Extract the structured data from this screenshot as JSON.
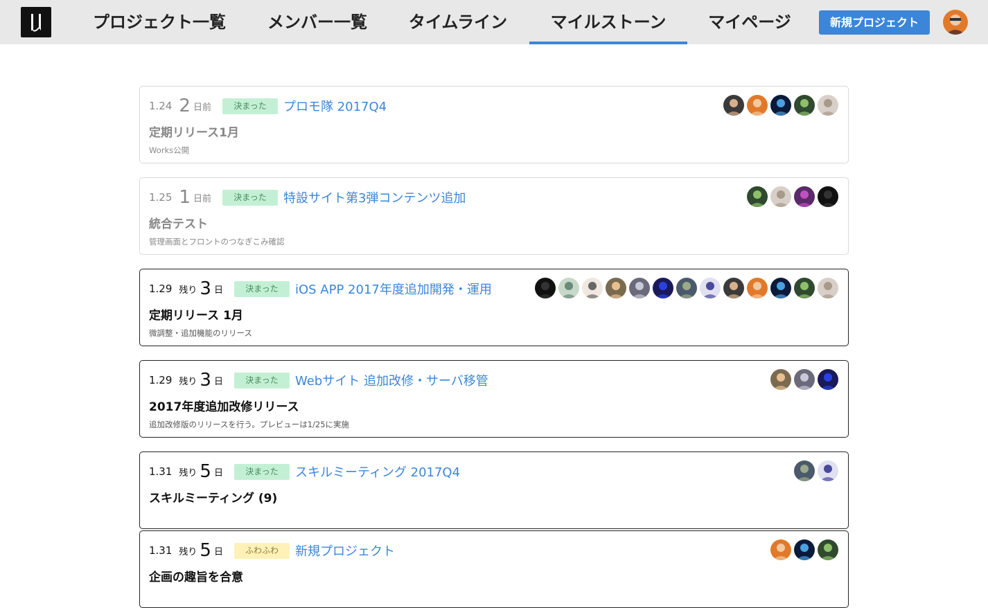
{
  "nav": {
    "tabs": [
      {
        "label": "プロジェクト一覧"
      },
      {
        "label": "メンバー一覧"
      },
      {
        "label": "タイムライン"
      },
      {
        "label": "マイルストーン",
        "active": true
      },
      {
        "label": "マイページ"
      }
    ],
    "new_project_label": "新規プロジェクト"
  },
  "colors": {
    "accent": "#3b86d9",
    "status_decided_bg": "#c3f0d4",
    "status_fuwa_bg": "#fff1b8"
  },
  "milestones": [
    {
      "date": "1.24",
      "days_prefix": "",
      "days": "2",
      "days_suffix": "日前",
      "status": "決まった",
      "project": "プロモ隊 2017Q4",
      "title": "定期リリース1月",
      "description": "Works公開",
      "avatar_count": 5
    },
    {
      "date": "1.25",
      "days_prefix": "",
      "days": "1",
      "days_suffix": "日前",
      "status": "決まった",
      "project": "特設サイト第3弾コンテンツ追加",
      "title": "統合テスト",
      "description": "管理画面とフロントのつなぎこみ確認",
      "avatar_count": 4
    },
    {
      "date": "1.29",
      "days_prefix": "残り",
      "days": "3",
      "days_suffix": "日",
      "status": "決まった",
      "project": "iOS APP 2017年度追加開発・運用",
      "title": "定期リリース 1月",
      "description": "微調整・追加機能のリリース",
      "avatar_count": 13
    },
    {
      "date": "1.29",
      "days_prefix": "残り",
      "days": "3",
      "days_suffix": "日",
      "status": "決まった",
      "project": "Webサイト 追加改修・サーバ移管",
      "title": "2017年度追加改修リリース",
      "description": "追加改修版のリリースを行う。プレビューは1/25に実施",
      "avatar_count": 3
    },
    {
      "date": "1.31",
      "days_prefix": "残り",
      "days": "5",
      "days_suffix": "日",
      "status": "決まった",
      "project": "スキルミーティング 2017Q4",
      "title": "スキルミーティング (9)",
      "description": "",
      "avatar_count": 2
    },
    {
      "date": "1.31",
      "days_prefix": "残り",
      "days": "5",
      "days_suffix": "日",
      "status": "ふわふわ",
      "project": "新規プロジェクト",
      "title": "企画の趣旨を合意",
      "description": "",
      "avatar_count": 3
    }
  ]
}
